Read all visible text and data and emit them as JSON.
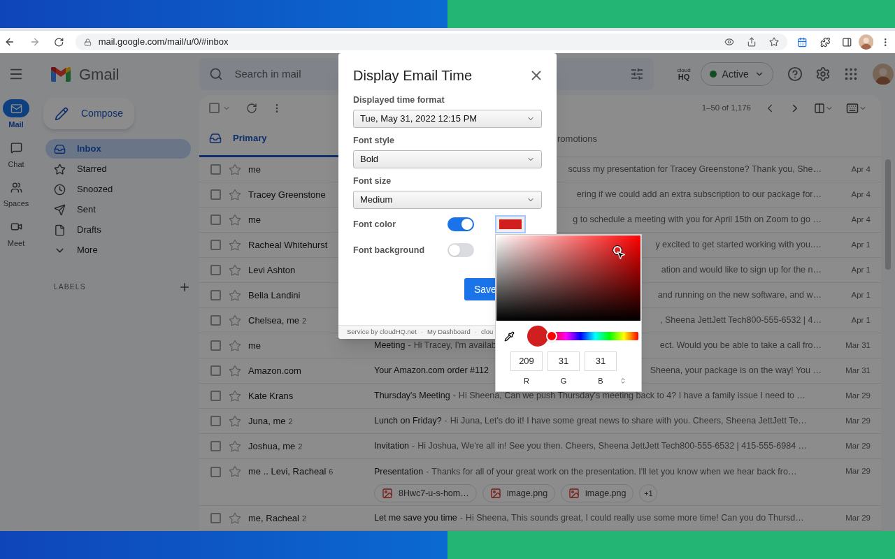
{
  "browser": {
    "url": "mail.google.com/mail/u/0/#inbox"
  },
  "header": {
    "app_name": "Gmail",
    "search_placeholder": "Search in mail",
    "logo_small": "cloud",
    "logo_big": "HQ",
    "status": "Active"
  },
  "rail": [
    {
      "label": "Mail",
      "selected": true
    },
    {
      "label": "Chat",
      "selected": false
    },
    {
      "label": "Spaces",
      "selected": false
    },
    {
      "label": "Meet",
      "selected": false
    }
  ],
  "compose": "Compose",
  "nav": [
    {
      "label": "Inbox",
      "selected": true
    },
    {
      "label": "Starred",
      "selected": false
    },
    {
      "label": "Snoozed",
      "selected": false
    },
    {
      "label": "Sent",
      "selected": false
    },
    {
      "label": "Drafts",
      "selected": false
    },
    {
      "label": "More",
      "selected": false
    }
  ],
  "labels_heading": "LABELS",
  "select_all": {
    "checked": false
  },
  "pagination": "1–50 of 1,176",
  "tabs": [
    {
      "label": "Primary",
      "selected": true
    },
    {
      "label": "romotions",
      "selected": false
    }
  ],
  "rows": [
    {
      "kind": "right",
      "checked": false,
      "sender": "me",
      "end": "scuss my presentation for Tracey Greenstone? Thank you, She…",
      "date": "Apr 4"
    },
    {
      "kind": "right",
      "checked": false,
      "sender": "Tracey Greenstone",
      "end": "ering if we could add an extra subscription to our package for…",
      "date": "Apr 4"
    },
    {
      "kind": "right",
      "checked": false,
      "sender": "me",
      "end": "g to schedule a meeting with you for April 15th on Zoom to go …",
      "date": "Apr 4"
    },
    {
      "kind": "right",
      "checked": false,
      "sender": "Racheal Whitehurst",
      "end": "y excited to get started working with you.…",
      "date": "Apr 1"
    },
    {
      "kind": "right",
      "checked": false,
      "sender": "Levi Ashton",
      "end": "ation and would like to sign up for the n…",
      "date": "Apr 1"
    },
    {
      "kind": "right",
      "checked": false,
      "sender": "Bella Landini",
      "end": "and running on the new software, and w…",
      "date": "Apr 1"
    },
    {
      "kind": "right",
      "checked": false,
      "sender": "Chelsea, me",
      "count": "2",
      "end": ", Sheena JettJett Tech800-555-6532 | 4…",
      "date": "Apr 1"
    },
    {
      "kind": "split",
      "checked": false,
      "sender": "me",
      "subject": "Meeting",
      "dash": "-",
      "snippet": "Hi Tracey, I'm availab",
      "end": "ect. Would you be able to take a call fro…",
      "date": "Mar 31"
    },
    {
      "kind": "split",
      "checked": false,
      "sender": "Amazon.com",
      "subject": "Your Amazon.com order #112",
      "end": "Sheena, your package is on the way! You …",
      "date": "Mar 31"
    },
    {
      "kind": "full",
      "checked": false,
      "sender": "Kate Krans",
      "subject": "Thursday's Meeting",
      "dash": "-",
      "snippet": "Hi Sheena, Can we push Thursday's meeting back to 4? I have a family issue I need to …",
      "date": "Mar 29"
    },
    {
      "kind": "full",
      "checked": false,
      "sender": "Juna, me",
      "count": "2",
      "subject": "Lunch on Friday?",
      "dash": "-",
      "snippet": "Hi Juna, Let's do it! I have some great news to share with you. Cheers, Sheena JettJett Te…",
      "date": "Mar 29"
    },
    {
      "kind": "full",
      "checked": false,
      "sender": "Joshua, me",
      "count": "2",
      "subject": "Invitation",
      "dash": "-",
      "snippet": "Hi Joshua, We're all in! See you then. Cheers, Sheena JettJett Tech800-555-6532 | 415-555-6984 …",
      "date": "Mar 29"
    },
    {
      "kind": "full",
      "checked": false,
      "sender": "me .. Levi, Racheal",
      "count": "6",
      "subject": "Presentation",
      "dash": "-",
      "snippet": "Thanks for all of your great work on the presentation. I'll let you know when we hear back fro…",
      "date": "Mar 29",
      "attachments": [
        "8Hwc7-u-s-hom…",
        "image.png",
        "image.png"
      ],
      "more": "+1"
    },
    {
      "kind": "full",
      "checked": false,
      "sender": "me, Racheal",
      "count": "2",
      "subject": "Let me save you time",
      "dash": "-",
      "snippet": "Hi Sheena, This sounds great, I could really use some more time! Can you do Thursd…",
      "date": "Mar 29"
    }
  ],
  "dialog": {
    "title": "Display Email Time",
    "fields": [
      {
        "label": "Displayed time format",
        "value": "Tue, May 31, 2022 12:15 PM"
      },
      {
        "label": "Font style",
        "value": "Bold"
      },
      {
        "label": "Font size",
        "value": "Medium"
      }
    ],
    "toggles": [
      {
        "label": "Font color",
        "on": true
      },
      {
        "label": "Font background",
        "on": false
      }
    ],
    "save": "Save",
    "footer": [
      "Service by cloudHQ.net",
      "·",
      "My Dashboard",
      "·",
      "clou"
    ]
  },
  "picker": {
    "hue": {
      "level": 0
    },
    "channels": [
      {
        "value": "209",
        "label": "R"
      },
      {
        "value": "31",
        "label": "G"
      },
      {
        "value": "31",
        "label": "B"
      }
    ]
  }
}
